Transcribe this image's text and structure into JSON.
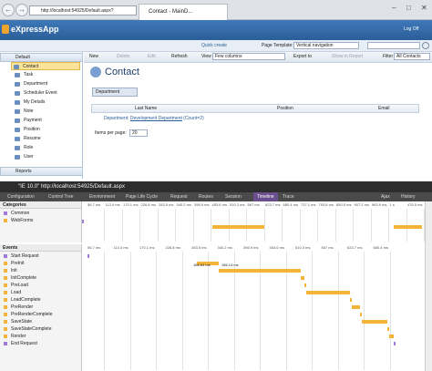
{
  "browser": {
    "address": "http://localhost:54925/Default.aspx?",
    "tab_title": "Contact - MainD...",
    "back_glyph": "←",
    "forward_glyph": "→",
    "min_glyph": "–",
    "max_glyph": "□",
    "close_glyph": "✕"
  },
  "app": {
    "logo": "eXpressApp",
    "logout": "Log Off",
    "quick_create": "Quick create",
    "page_template_label": "Page Template:",
    "page_template_value": "Vertical navigation",
    "search_placeholder": "",
    "accent": "#2b5e99"
  },
  "nav": {
    "default_group": "Default",
    "items": [
      {
        "label": "Contact",
        "selected": true
      },
      {
        "label": "Task"
      },
      {
        "label": "Department"
      },
      {
        "label": "Scheduler Event"
      },
      {
        "label": "My Details"
      },
      {
        "label": "Note"
      },
      {
        "label": "Payment"
      },
      {
        "label": "Position"
      },
      {
        "label": "Resume"
      },
      {
        "label": "Role"
      },
      {
        "label": "User"
      }
    ],
    "reports_group": "Reports"
  },
  "toolbar": {
    "new": "New",
    "delete": "Delete",
    "edit": "Edit",
    "refresh": "Refresh",
    "view_label": "View",
    "view_value": "Few columns",
    "export": "Export to",
    "show_in_report": "Show in Report",
    "filter_label": "Filter",
    "filter_value": "All Contacts"
  },
  "main": {
    "title": "Contact",
    "group_chip": "Department",
    "columns": [
      "Last Name",
      "Position",
      "Email"
    ],
    "group_row_prefix": "Department: ",
    "group_row_link": "Development Department",
    "group_row_count": "(Count=2)",
    "items_per_page_label": "Items per page:",
    "items_per_page_value": "20"
  },
  "devtools": {
    "title": "\"IE 10.0\" http://localhost:54925/Default.aspx",
    "tabs": [
      "Configuration",
      "Control Tree",
      "Environment",
      "Page Life Cycle",
      "Request",
      "Routes",
      "Session",
      "Timeline",
      "Trace"
    ],
    "active_tab": "Timeline",
    "right_tabs": [
      "Ajax",
      "History"
    ],
    "categories_header": "Categories",
    "categories": [
      {
        "label": "Common",
        "color": "#a07ad6"
      },
      {
        "label": "WebForms",
        "color": "#f4b43a"
      }
    ],
    "cat_ticks": [
      "56.7 ms",
      "113.4 ms",
      "170.1 ms",
      "226.8 ms",
      "283.5 ms",
      "340.2 ms",
      "396.9 ms",
      "453.6 ms",
      "510.3 ms",
      "567 ms",
      "623.7 ms",
      "680.4 ms",
      "737.1 ms",
      "793.8 ms",
      "850.5 ms",
      "907.2 ms",
      "963.9 ms",
      "1 s",
      "476.5 ms"
    ],
    "events_header": "Events",
    "ev_ticks": [
      "56.7 ms",
      "113.4 ms",
      "170.1 ms",
      "226.8 ms",
      "283.5 ms",
      "340.2 ms",
      "396.9 ms",
      "453.6 ms",
      "510.3 ms",
      "567 ms",
      "623.7 ms",
      "680.4 ms"
    ],
    "hover_labels": [
      "186.64 ms",
      "186.14 ms"
    ],
    "events": [
      {
        "label": "Start Request",
        "color": "#a07ad6"
      },
      {
        "label": "PreInit",
        "color": "#f4b43a"
      },
      {
        "label": "Init",
        "color": "#f4b43a"
      },
      {
        "label": "InitComplete",
        "color": "#f4b43a"
      },
      {
        "label": "PreLoad",
        "color": "#f4b43a"
      },
      {
        "label": "Load",
        "color": "#f4b43a"
      },
      {
        "label": "LoadComplete",
        "color": "#f4b43a"
      },
      {
        "label": "PreRender",
        "color": "#f4b43a"
      },
      {
        "label": "PreRenderComplete",
        "color": "#f4b43a"
      },
      {
        "label": "SaveState",
        "color": "#f4b43a"
      },
      {
        "label": "SaveStateComplete",
        "color": "#f4b43a"
      },
      {
        "label": "Render",
        "color": "#f4b43a"
      },
      {
        "label": "End Request",
        "color": "#a07ad6"
      }
    ]
  }
}
